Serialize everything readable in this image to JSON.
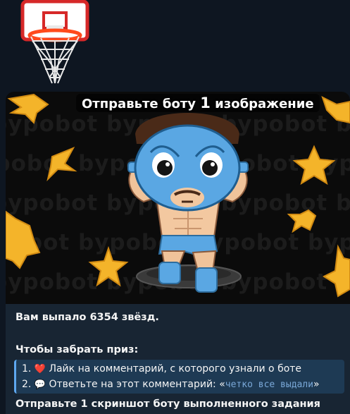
{
  "sticker": {
    "icon": "basketball-hoop-icon"
  },
  "message": {
    "media_caption_prefix": "Отправьте боту ",
    "media_caption_number": "1",
    "media_caption_suffix": " изображение",
    "watermark_text": "bypobot",
    "won_line": "Вам выпало 6354 звёзд.",
    "prize_heading": "Чтобы забрать приз:",
    "steps": [
      {
        "num": "1.",
        "emoji": "❤️",
        "text": "Лайк на комментарий, с которого узнали о боте"
      },
      {
        "num": "2.",
        "emoji": "💬",
        "text_prefix": "Ответьте на этот комментарий: «",
        "code": "четко все выдали",
        "text_suffix": "»"
      }
    ],
    "final_line": "Отправьте 1 скриншот боту выполненного задания"
  },
  "colors": {
    "background": "#0e1621",
    "bubble": "#182533",
    "quote_bg": "#1e3a54",
    "quote_border": "#5ea8f0",
    "star": "#f4b42a",
    "mask": "#5aa7e3"
  }
}
